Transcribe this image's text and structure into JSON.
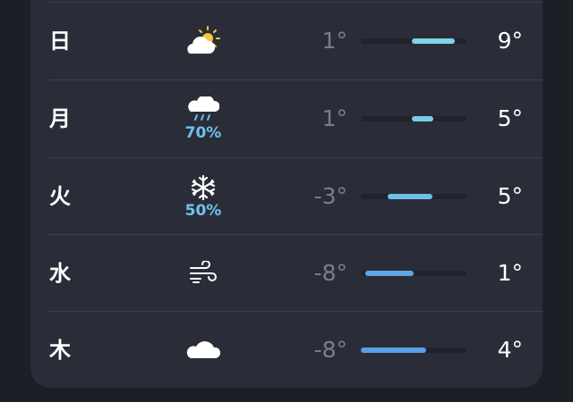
{
  "forecast": {
    "days": [
      {
        "day": "日",
        "icon": "partly-sunny-icon",
        "precip": "",
        "low": "1°",
        "high": "9°",
        "bar": {
          "start": 0.48,
          "end": 0.89,
          "color": "#7fd3e6"
        }
      },
      {
        "day": "月",
        "icon": "cloud-rain-icon",
        "precip": "70%",
        "low": "1°",
        "high": "5°",
        "bar": {
          "start": 0.48,
          "end": 0.69,
          "color": "#78cde8"
        }
      },
      {
        "day": "火",
        "icon": "snowflake-icon",
        "precip": "50%",
        "low": "-3°",
        "high": "5°",
        "bar": {
          "start": 0.25,
          "end": 0.68,
          "color": "#6fc0e8"
        }
      },
      {
        "day": "水",
        "icon": "wind-icon",
        "precip": "",
        "low": "-8°",
        "high": "1°",
        "bar": {
          "start": 0.04,
          "end": 0.5,
          "color": "#5ea6e8"
        }
      },
      {
        "day": "木",
        "icon": "cloud-icon",
        "precip": "",
        "low": "-8°",
        "high": "4°",
        "bar": {
          "start": 0.0,
          "end": 0.62,
          "color": "#5a9ee8"
        }
      }
    ]
  }
}
